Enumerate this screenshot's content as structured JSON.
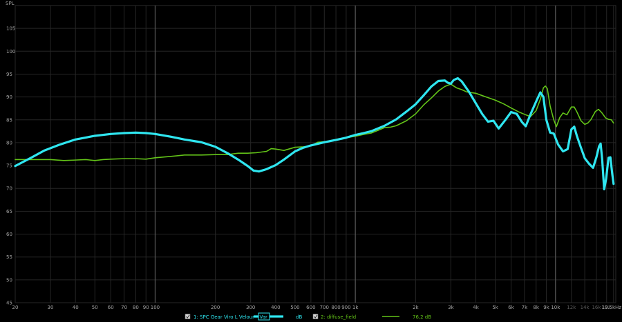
{
  "chart_data": {
    "type": "line",
    "ylabel": "SPL",
    "xlabel": "",
    "x_scale": "log",
    "xlim": [
      20,
      20000
    ],
    "ylim": [
      45,
      110
    ],
    "y_ticks": [
      45,
      50,
      55,
      60,
      65,
      70,
      75,
      80,
      85,
      90,
      95,
      100,
      105
    ],
    "x_ticks": [
      {
        "value": 20,
        "label": "20"
      },
      {
        "value": 30,
        "label": "30"
      },
      {
        "value": 40,
        "label": "40"
      },
      {
        "value": 50,
        "label": "50"
      },
      {
        "value": 60,
        "label": "60"
      },
      {
        "value": 70,
        "label": "70"
      },
      {
        "value": 80,
        "label": "80"
      },
      {
        "value": 90,
        "label": "90"
      },
      {
        "value": 100,
        "label": "100"
      },
      {
        "value": 200,
        "label": "200"
      },
      {
        "value": 300,
        "label": "300"
      },
      {
        "value": 400,
        "label": "400"
      },
      {
        "value": 500,
        "label": "500"
      },
      {
        "value": 600,
        "label": "600"
      },
      {
        "value": 700,
        "label": "700"
      },
      {
        "value": 800,
        "label": "800"
      },
      {
        "value": 900,
        "label": "900"
      },
      {
        "value": 1000,
        "label": "1k"
      },
      {
        "value": 2000,
        "label": "2k"
      },
      {
        "value": 3000,
        "label": "3k"
      },
      {
        "value": 4000,
        "label": "4k"
      },
      {
        "value": 5000,
        "label": "5k"
      },
      {
        "value": 6000,
        "label": "6k"
      },
      {
        "value": 7000,
        "label": "7k"
      },
      {
        "value": 8000,
        "label": "8k"
      },
      {
        "value": 9000,
        "label": "9k"
      },
      {
        "value": 10000,
        "label": "10k"
      },
      {
        "value": 12000,
        "label": "12k",
        "dim": true
      },
      {
        "value": 14000,
        "label": "14k",
        "dim": true
      },
      {
        "value": 16000,
        "label": "16k",
        "dim": true
      },
      {
        "value": 18000,
        "label": "18k",
        "dim": true
      },
      {
        "value": 19500,
        "label": "19.5kHz"
      }
    ],
    "major_lines": [
      100,
      1000,
      10000
    ],
    "grid": true,
    "series": [
      {
        "name": "1: SPC Gear Viro L Velour",
        "color": "#2fe6f0",
        "width": 3.2,
        "points": [
          [
            20,
            74.9
          ],
          [
            24,
            76.7
          ],
          [
            28,
            78.3
          ],
          [
            33,
            79.5
          ],
          [
            40,
            80.7
          ],
          [
            50,
            81.5
          ],
          [
            60,
            81.9
          ],
          [
            70,
            82.1
          ],
          [
            80,
            82.2
          ],
          [
            90,
            82.1
          ],
          [
            100,
            81.9
          ],
          [
            120,
            81.3
          ],
          [
            140,
            80.7
          ],
          [
            170,
            80.1
          ],
          [
            200,
            79.1
          ],
          [
            230,
            77.7
          ],
          [
            260,
            76.3
          ],
          [
            290,
            74.9
          ],
          [
            310,
            73.9
          ],
          [
            330,
            73.7
          ],
          [
            360,
            74.2
          ],
          [
            400,
            75.1
          ],
          [
            440,
            76.3
          ],
          [
            500,
            78.1
          ],
          [
            550,
            78.9
          ],
          [
            600,
            79.4
          ],
          [
            700,
            80.1
          ],
          [
            800,
            80.6
          ],
          [
            900,
            81.1
          ],
          [
            1000,
            81.7
          ],
          [
            1100,
            82.1
          ],
          [
            1200,
            82.5
          ],
          [
            1400,
            83.7
          ],
          [
            1600,
            85.1
          ],
          [
            1800,
            86.8
          ],
          [
            2000,
            88.4
          ],
          [
            2200,
            90.4
          ],
          [
            2400,
            92.3
          ],
          [
            2600,
            93.5
          ],
          [
            2800,
            93.6
          ],
          [
            2900,
            93.1
          ],
          [
            3000,
            92.9
          ],
          [
            3100,
            93.7
          ],
          [
            3250,
            94.1
          ],
          [
            3400,
            93.4
          ],
          [
            3700,
            91.1
          ],
          [
            4000,
            88.6
          ],
          [
            4300,
            86.3
          ],
          [
            4600,
            84.6
          ],
          [
            4900,
            84.8
          ],
          [
            5200,
            83.1
          ],
          [
            5600,
            84.9
          ],
          [
            6000,
            86.7
          ],
          [
            6400,
            86.3
          ],
          [
            6800,
            84.5
          ],
          [
            7100,
            83.6
          ],
          [
            7500,
            86.2
          ],
          [
            8000,
            89.0
          ],
          [
            8400,
            91.0
          ],
          [
            8700,
            90.0
          ],
          [
            9000,
            85.0
          ],
          [
            9400,
            82.2
          ],
          [
            9800,
            82.0
          ],
          [
            10300,
            79.6
          ],
          [
            10900,
            78.1
          ],
          [
            11500,
            78.6
          ],
          [
            12000,
            82.9
          ],
          [
            12400,
            83.5
          ],
          [
            12800,
            81.4
          ],
          [
            13400,
            78.9
          ],
          [
            14000,
            76.6
          ],
          [
            14700,
            75.4
          ],
          [
            15400,
            74.5
          ],
          [
            16000,
            76.8
          ],
          [
            16500,
            79.2
          ],
          [
            16800,
            79.8
          ],
          [
            17100,
            76.4
          ],
          [
            17500,
            69.8
          ],
          [
            17900,
            72.1
          ],
          [
            18400,
            76.7
          ],
          [
            18800,
            76.8
          ],
          [
            19200,
            73.2
          ],
          [
            19500,
            71.0
          ]
        ]
      },
      {
        "name": "2: diffuse_field",
        "color": "#63c418",
        "width": 1.6,
        "points": [
          [
            20,
            76.3
          ],
          [
            25,
            76.3
          ],
          [
            30,
            76.3
          ],
          [
            35,
            76.1
          ],
          [
            40,
            76.2
          ],
          [
            45,
            76.3
          ],
          [
            50,
            76.1
          ],
          [
            55,
            76.3
          ],
          [
            60,
            76.4
          ],
          [
            70,
            76.5
          ],
          [
            80,
            76.5
          ],
          [
            90,
            76.4
          ],
          [
            100,
            76.7
          ],
          [
            120,
            77.0
          ],
          [
            140,
            77.3
          ],
          [
            170,
            77.3
          ],
          [
            200,
            77.4
          ],
          [
            230,
            77.4
          ],
          [
            260,
            77.7
          ],
          [
            290,
            77.7
          ],
          [
            320,
            77.8
          ],
          [
            360,
            78.1
          ],
          [
            380,
            78.7
          ],
          [
            400,
            78.6
          ],
          [
            440,
            78.3
          ],
          [
            500,
            79.0
          ],
          [
            550,
            79.1
          ],
          [
            600,
            79.3
          ],
          [
            650,
            80.1
          ],
          [
            700,
            80.2
          ],
          [
            800,
            80.7
          ],
          [
            900,
            81.1
          ],
          [
            1000,
            81.4
          ],
          [
            1100,
            81.8
          ],
          [
            1200,
            82.1
          ],
          [
            1300,
            82.7
          ],
          [
            1400,
            83.3
          ],
          [
            1500,
            83.4
          ],
          [
            1600,
            83.7
          ],
          [
            1800,
            84.8
          ],
          [
            2000,
            86.3
          ],
          [
            2200,
            88.3
          ],
          [
            2400,
            89.8
          ],
          [
            2600,
            91.3
          ],
          [
            2800,
            92.3
          ],
          [
            3000,
            92.8
          ],
          [
            3200,
            92.0
          ],
          [
            3400,
            91.6
          ],
          [
            3600,
            91.1
          ],
          [
            4000,
            90.8
          ],
          [
            4500,
            90.0
          ],
          [
            5000,
            89.3
          ],
          [
            5500,
            88.5
          ],
          [
            6000,
            87.6
          ],
          [
            6500,
            86.8
          ],
          [
            7000,
            86.2
          ],
          [
            7500,
            85.7
          ],
          [
            8000,
            87.0
          ],
          [
            8400,
            89.5
          ],
          [
            8700,
            92.0
          ],
          [
            8900,
            92.4
          ],
          [
            9100,
            91.8
          ],
          [
            9400,
            88.0
          ],
          [
            9800,
            85.0
          ],
          [
            10100,
            83.5
          ],
          [
            10500,
            85.5
          ],
          [
            10900,
            86.5
          ],
          [
            11400,
            86.1
          ],
          [
            12000,
            87.8
          ],
          [
            12400,
            87.8
          ],
          [
            12800,
            86.7
          ],
          [
            13400,
            84.8
          ],
          [
            14000,
            84.0
          ],
          [
            14500,
            84.3
          ],
          [
            15000,
            85.0
          ],
          [
            15800,
            86.8
          ],
          [
            16400,
            87.3
          ],
          [
            17000,
            86.6
          ],
          [
            17800,
            85.4
          ],
          [
            18400,
            85.1
          ],
          [
            19000,
            85.0
          ],
          [
            19500,
            84.3
          ]
        ]
      }
    ]
  },
  "legend": {
    "series1_label": "1: SPC Gear Viro L Velour",
    "series1_unit": "dB",
    "scale_box": "Var",
    "series2_label": "2: diffuse_field",
    "series2_value": "76,2 dB"
  }
}
